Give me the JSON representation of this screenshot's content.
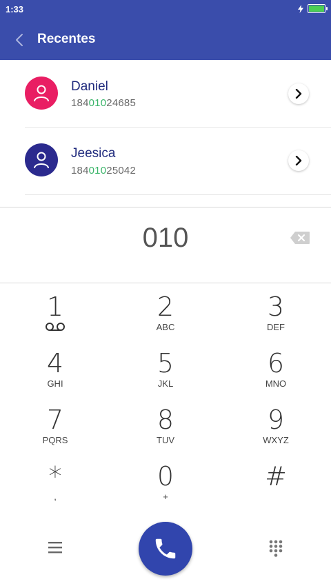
{
  "status": {
    "time": "1:33"
  },
  "header": {
    "title": "Recentes"
  },
  "contacts": [
    {
      "name": "Daniel",
      "number_prefix": "184",
      "number_match": "010",
      "number_suffix": "24685",
      "avatar_color": "#e91e63"
    },
    {
      "name": "Jeesica",
      "number_prefix": "184",
      "number_match": "010",
      "number_suffix": "25042",
      "avatar_color": "#2b2a8e"
    }
  ],
  "dialer": {
    "input": "010"
  },
  "keypad": [
    {
      "digit": "1",
      "letters": ""
    },
    {
      "digit": "2",
      "letters": "ABC"
    },
    {
      "digit": "3",
      "letters": "DEF"
    },
    {
      "digit": "4",
      "letters": "GHI"
    },
    {
      "digit": "5",
      "letters": "JKL"
    },
    {
      "digit": "6",
      "letters": "MNO"
    },
    {
      "digit": "7",
      "letters": "PQRS"
    },
    {
      "digit": "8",
      "letters": "TUV"
    },
    {
      "digit": "9",
      "letters": "WXYZ"
    },
    {
      "digit": "*",
      "letters": ","
    },
    {
      "digit": "0",
      "letters": "+"
    },
    {
      "digit": "#",
      "letters": ""
    }
  ],
  "colors": {
    "accent": "#3a4dab",
    "match": "#3bb56a",
    "call_button": "#3145ad"
  },
  "icons": {
    "back": "chevron-left-icon",
    "chevron": "chevron-right-icon",
    "backspace": "backspace-icon",
    "voicemail": "voicemail-icon",
    "menu": "menu-icon",
    "call": "phone-icon",
    "dialpad": "dialpad-icon",
    "avatar": "person-icon",
    "charging": "bolt-icon",
    "battery": "battery-icon"
  }
}
